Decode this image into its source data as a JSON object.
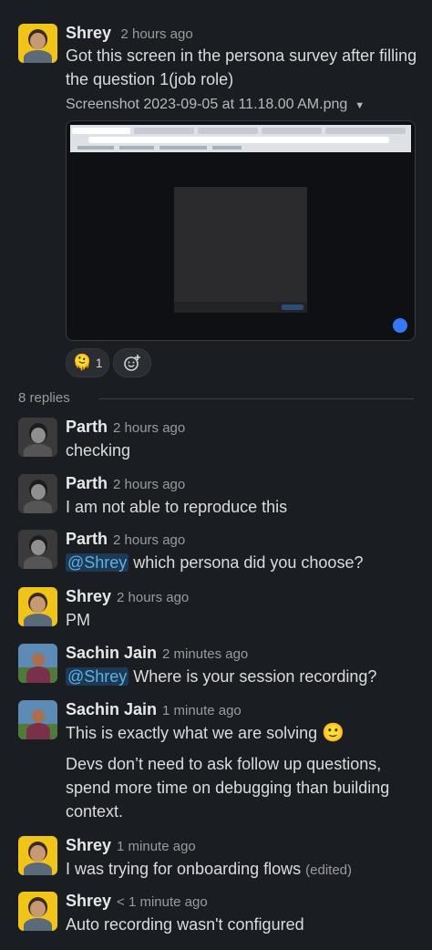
{
  "parent": {
    "name": "Shrey",
    "time": "2 hours ago",
    "text_line1": "Got this screen in the persona survey after filling",
    "text_line2": "the question 1(job role)",
    "file_name": "Screenshot 2023-09-05 at 11.18.00 AM.png",
    "file_caret": "▼",
    "reaction_emoji": "🫠",
    "reaction_count": "1",
    "add_reaction_icon": "add-emoji-icon"
  },
  "thread": {
    "replies_label": "8 replies"
  },
  "replies": [
    {
      "name": "Parth",
      "time": "2 hours ago",
      "text": "checking"
    },
    {
      "name": "Parth",
      "time": "2 hours ago",
      "text": "I am not able to reproduce this"
    },
    {
      "name": "Parth",
      "time": "2 hours ago",
      "mention": "@Shrey",
      "text": " which persona did you choose?"
    },
    {
      "name": "Shrey",
      "time": "2 hours ago",
      "text": "PM"
    },
    {
      "name": "Sachin Jain",
      "time": "2 minutes ago",
      "mention": "@Shrey",
      "text": " Where is your session recording?"
    },
    {
      "name": "Sachin Jain",
      "time": "1 minute ago",
      "text": "This is exactly what we are solving",
      "emoji": "🙂",
      "text2_line1": "Devs don’t need to ask follow up questions,",
      "text2_line2": "spend more time on debugging than building",
      "text2_line3": "context."
    },
    {
      "name": "Shrey",
      "time": "1 minute ago",
      "text": "I was trying for onboarding flows",
      "edited": "(edited)"
    },
    {
      "name": "Shrey",
      "time": "< 1 minute ago",
      "text": "Auto recording wasn't configured"
    }
  ],
  "colors": {
    "background": "#1a1d21",
    "mention_bg": "#1d3a55",
    "mention_text": "#5db0e8"
  }
}
